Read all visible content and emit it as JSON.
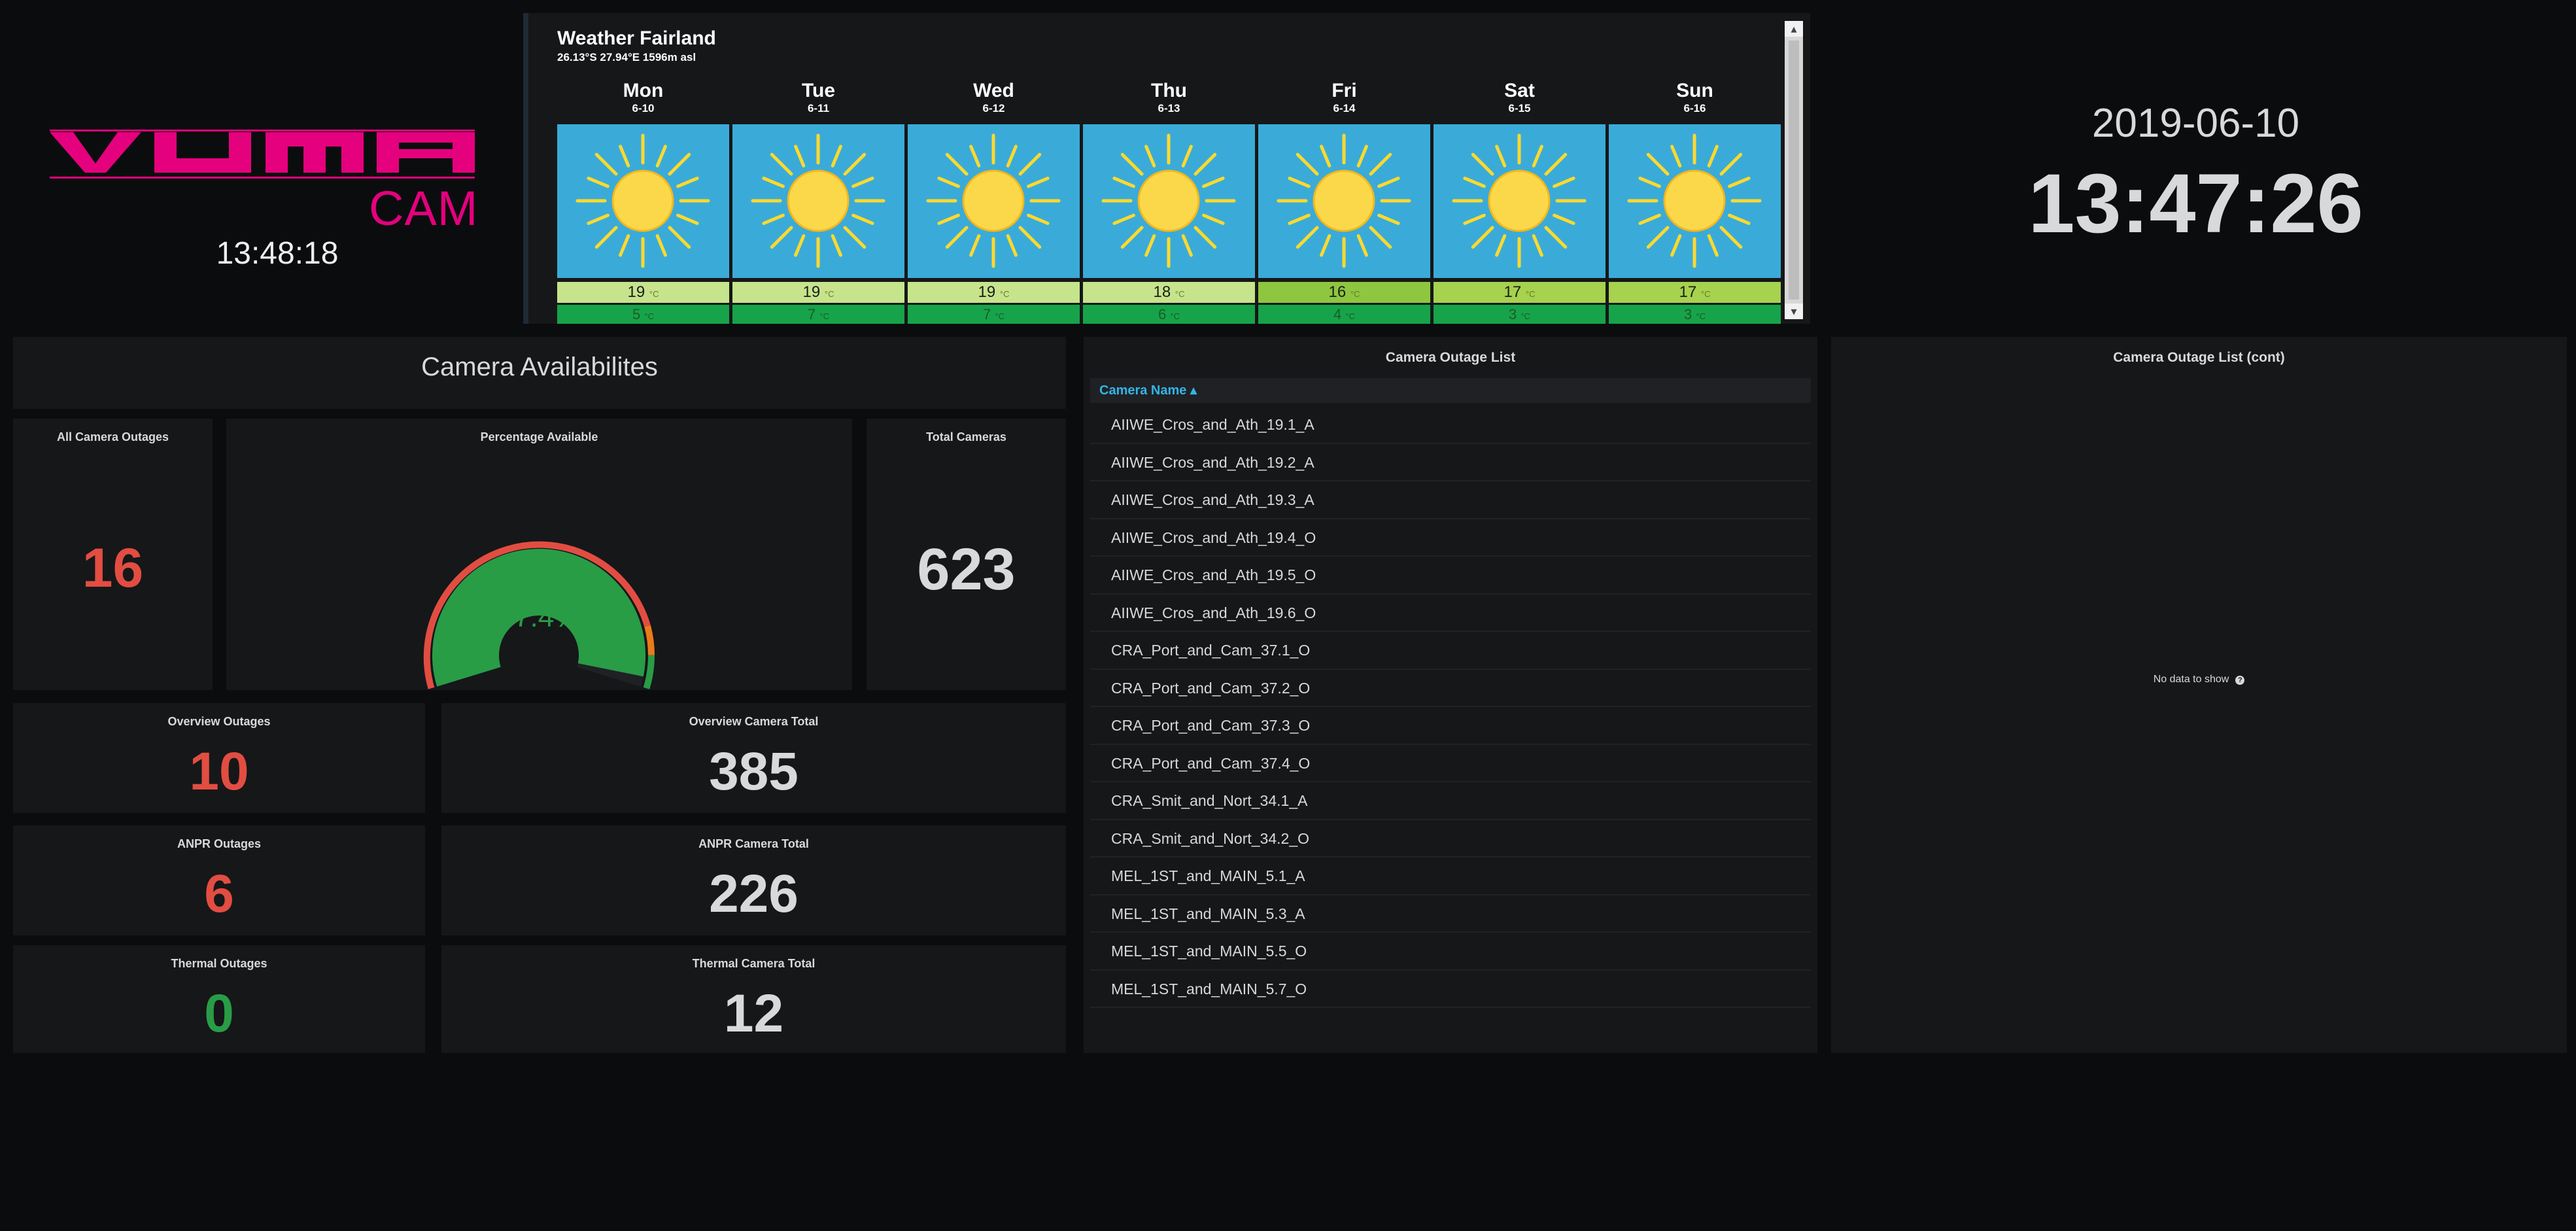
{
  "logo": {
    "brand_top": "VUMA",
    "brand_bottom": "CAM",
    "clock": "13:48:18",
    "brand_color": "#e5007e"
  },
  "weather": {
    "title": "Weather Fairland",
    "subtitle": "26.13°S 27.94°E 1596m asl",
    "unit": "°C",
    "days": [
      {
        "name": "Mon",
        "date": "6-10",
        "hi": "19",
        "lo": "5",
        "icon": "sun-icon",
        "hi_color": "#c6e48b"
      },
      {
        "name": "Tue",
        "date": "6-11",
        "hi": "19",
        "lo": "7",
        "icon": "sun-icon",
        "hi_color": "#c6e48b"
      },
      {
        "name": "Wed",
        "date": "6-12",
        "hi": "19",
        "lo": "7",
        "icon": "sun-icon",
        "hi_color": "#c6e48b"
      },
      {
        "name": "Thu",
        "date": "6-13",
        "hi": "18",
        "lo": "6",
        "icon": "sun-icon",
        "hi_color": "#c6e48b"
      },
      {
        "name": "Fri",
        "date": "6-14",
        "hi": "16",
        "lo": "4",
        "icon": "sun-icon",
        "hi_color": "#8ec63f"
      },
      {
        "name": "Sat",
        "date": "6-15",
        "hi": "17",
        "lo": "3",
        "icon": "sun-icon",
        "hi_color": "#a6d24e"
      },
      {
        "name": "Sun",
        "date": "6-16",
        "hi": "17",
        "lo": "3",
        "icon": "sun-icon",
        "hi_color": "#a6d24e"
      }
    ]
  },
  "clock": {
    "date": "2019-06-10",
    "time": "13:47:26"
  },
  "availability": {
    "title": "Camera Availabilites",
    "all_outages": {
      "label": "All Camera Outages",
      "value": "16"
    },
    "percentage": {
      "label": "Percentage Available",
      "value": "97.4%",
      "fraction": 0.974
    },
    "total": {
      "label": "Total Cameras",
      "value": "623"
    },
    "overview_outages": {
      "label": "Overview Outages",
      "value": "10"
    },
    "overview_total": {
      "label": "Overview Camera Total",
      "value": "385"
    },
    "anpr_outages": {
      "label": "ANPR Outages",
      "value": "6"
    },
    "anpr_total": {
      "label": "ANPR Camera Total",
      "value": "226"
    },
    "thermal_outages": {
      "label": "Thermal Outages",
      "value": "0"
    },
    "thermal_total": {
      "label": "Thermal Camera Total",
      "value": "12"
    }
  },
  "outage_list": {
    "title": "Camera Outage List",
    "column": "Camera Name ▴",
    "rows": [
      "AIIWE_Cros_and_Ath_19.1_A",
      "AIIWE_Cros_and_Ath_19.2_A",
      "AIIWE_Cros_and_Ath_19.3_A",
      "AIIWE_Cros_and_Ath_19.4_O",
      "AIIWE_Cros_and_Ath_19.5_O",
      "AIIWE_Cros_and_Ath_19.6_O",
      "CRA_Port_and_Cam_37.1_O",
      "CRA_Port_and_Cam_37.2_O",
      "CRA_Port_and_Cam_37.3_O",
      "CRA_Port_and_Cam_37.4_O",
      "CRA_Smit_and_Nort_34.1_A",
      "CRA_Smit_and_Nort_34.2_O",
      "MEL_1ST_and_MAIN_5.1_A",
      "MEL_1ST_and_MAIN_5.3_A",
      "MEL_1ST_and_MAIN_5.5_O",
      "MEL_1ST_and_MAIN_5.7_O"
    ]
  },
  "outage_list_cont": {
    "title": "Camera Outage List (cont)",
    "nodata": "No data to show"
  },
  "colors": {
    "red": "#e24d42",
    "green": "#299c46",
    "sky": "#3aabd8",
    "panel": "#161719",
    "background": "#0b0c0e",
    "gauge_track": "#1f2125"
  }
}
